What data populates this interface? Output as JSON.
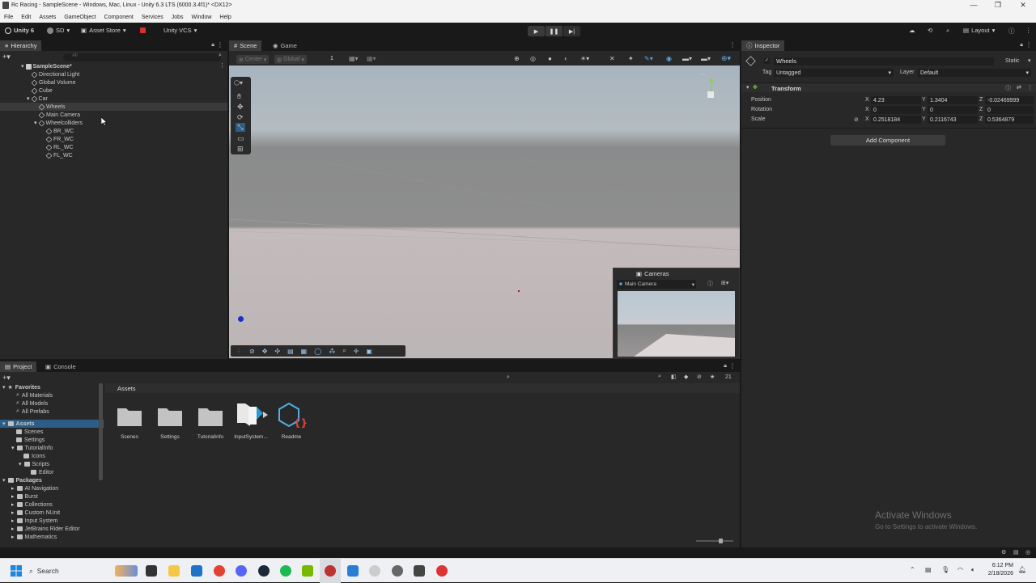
{
  "window": {
    "title": "Rc Racing - SampleScene - Windows, Mac, Linux - Unity 6.3 LTS (6000.3.4f1)* <DX12>",
    "controls": [
      "—",
      "❐",
      "✕"
    ]
  },
  "menu": [
    "File",
    "Edit",
    "Assets",
    "GameObject",
    "Component",
    "Services",
    "Jobs",
    "Window",
    "Help"
  ],
  "toolbar": {
    "unity_label": "Unity 6",
    "account": "SD",
    "asset_store": "Asset Store",
    "vcs": "Unity VCS",
    "layout": "Layout"
  },
  "hierarchy": {
    "tab": "Hierarchy",
    "search_placeholder": "All",
    "items": [
      {
        "label": "SampleScene*"
      },
      {
        "label": "Directional Light"
      },
      {
        "label": "Global Volume"
      },
      {
        "label": "Cube"
      },
      {
        "label": "Car"
      },
      {
        "label": "Wheels"
      },
      {
        "label": "Main Camera"
      },
      {
        "label": "Wheelcolliders"
      },
      {
        "label": "BR_WC"
      },
      {
        "label": "FR_WC"
      },
      {
        "label": "RL_WC"
      },
      {
        "label": "FL_WC"
      }
    ]
  },
  "scene": {
    "tabs": [
      "Scene",
      "Game"
    ],
    "pivot": "Center",
    "space": "Global",
    "grid_snap": "1",
    "cameras_overlay": {
      "title": "Cameras",
      "selected": "Main Camera"
    }
  },
  "inspector": {
    "tab": "Inspector",
    "object_name": "Wheels",
    "static_label": "Static",
    "tag_label": "Tag",
    "tag_value": "Untagged",
    "layer_label": "Layer",
    "layer_value": "Default",
    "component": "Transform",
    "position": {
      "label": "Position",
      "x": "4.23",
      "y": "1.3404",
      "z": "-0.02469999"
    },
    "rotation": {
      "label": "Rotation",
      "x": "0",
      "y": "0",
      "z": "0"
    },
    "scale": {
      "label": "Scale",
      "x": "0.2518184",
      "y": "0.2116743",
      "z": "0.5364879"
    },
    "add_component": "Add Component",
    "axis": {
      "x": "X",
      "y": "Y",
      "z": "Z"
    }
  },
  "project": {
    "tabs": [
      "Project",
      "Console"
    ],
    "count": "21",
    "breadcrumb": "Assets",
    "favorites": {
      "label": "Favorites",
      "items": [
        "All Materials",
        "All Models",
        "All Prefabs"
      ]
    },
    "assets_tree": {
      "label": "Assets",
      "items": [
        "Scenes",
        "Settings",
        "TutorialInfo",
        "Icons",
        "Scripts",
        "Editor"
      ]
    },
    "packages": {
      "label": "Packages",
      "items": [
        "AI Navigation",
        "Burst",
        "Collections",
        "Custom NUnit",
        "Input System",
        "JetBrains Rider Editor",
        "Mathematics"
      ]
    },
    "grid": [
      {
        "label": "Scenes"
      },
      {
        "label": "Settings"
      },
      {
        "label": "TutorialInfo"
      },
      {
        "label": "InputSystem..."
      },
      {
        "label": "Readme"
      }
    ]
  },
  "watermark": {
    "line1": "Activate Windows",
    "line2": "Go to Settings to activate Windows."
  },
  "taskbar": {
    "search": "Search",
    "time": "6:12 PM",
    "date": "2/18/2026"
  },
  "colors": {
    "accent": "#2c5d87",
    "selection": "#2c5d87",
    "record": "#d9322e"
  }
}
